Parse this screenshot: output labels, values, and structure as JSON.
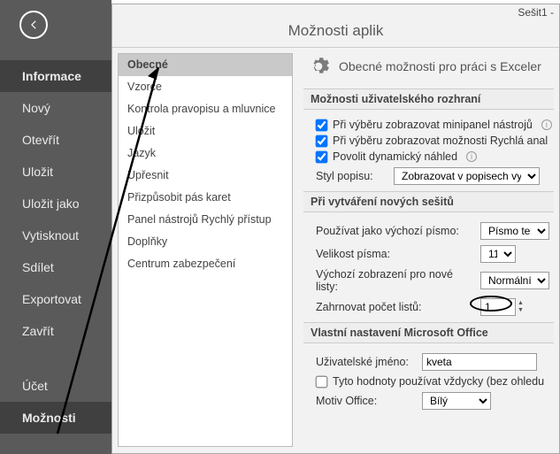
{
  "workbook_name": "Sešit1 -",
  "dialog_title": "Možnosti aplik",
  "nav": [
    "Informace",
    "Nový",
    "Otevřít",
    "Uložit",
    "Uložit jako",
    "Vytisknout",
    "Sdílet",
    "Exportovat",
    "Zavřít"
  ],
  "nav2": [
    "Účet",
    "Možnosti"
  ],
  "nav_selected": "Možnosti",
  "nav_highlight": "Informace",
  "categories": [
    "Obecné",
    "Vzorce",
    "Kontrola pravopisu a mluvnice",
    "Uložit",
    "Jazyk",
    "Upřesnit",
    "Přizpůsobit pás karet",
    "Panel nástrojů Rychlý přístup",
    "Doplňky",
    "Centrum zabezpečení"
  ],
  "categories_selected": "Obecné",
  "content_header": "Obecné možnosti pro práci s Exceler",
  "section_ui": {
    "title": "Možnosti uživatelského rozhraní",
    "minipane": "Při výběru zobrazovat minipanel nástrojů",
    "quick": "Při výběru zobrazovat možnosti Rychlá anal",
    "dynprev": "Povolit dynamický náhled",
    "styllbl": "Styl popisu:",
    "stylval": "Zobrazovat v popisech vysvětlen"
  },
  "section_new": {
    "title": "Při vytváření nových sešitů",
    "font_lbl": "Používat jako výchozí písmo:",
    "font_val": "Písmo textu",
    "size_lbl": "Velikost písma:",
    "size_val": "11",
    "view_lbl": "Výchozí zobrazení pro nové listy:",
    "view_val": "Normální zo",
    "sheets_lbl": "Zahrnovat počet listů:",
    "sheets_val": "1"
  },
  "section_user": {
    "title": "Vlastní nastavení Microsoft Office",
    "name_lbl": "Uživatelské jméno:",
    "name_val": "kveta",
    "always_lbl": "Tyto hodnoty používat vždycky (bez ohledu",
    "theme_lbl": "Motiv Office:",
    "theme_val": "Bílý"
  }
}
